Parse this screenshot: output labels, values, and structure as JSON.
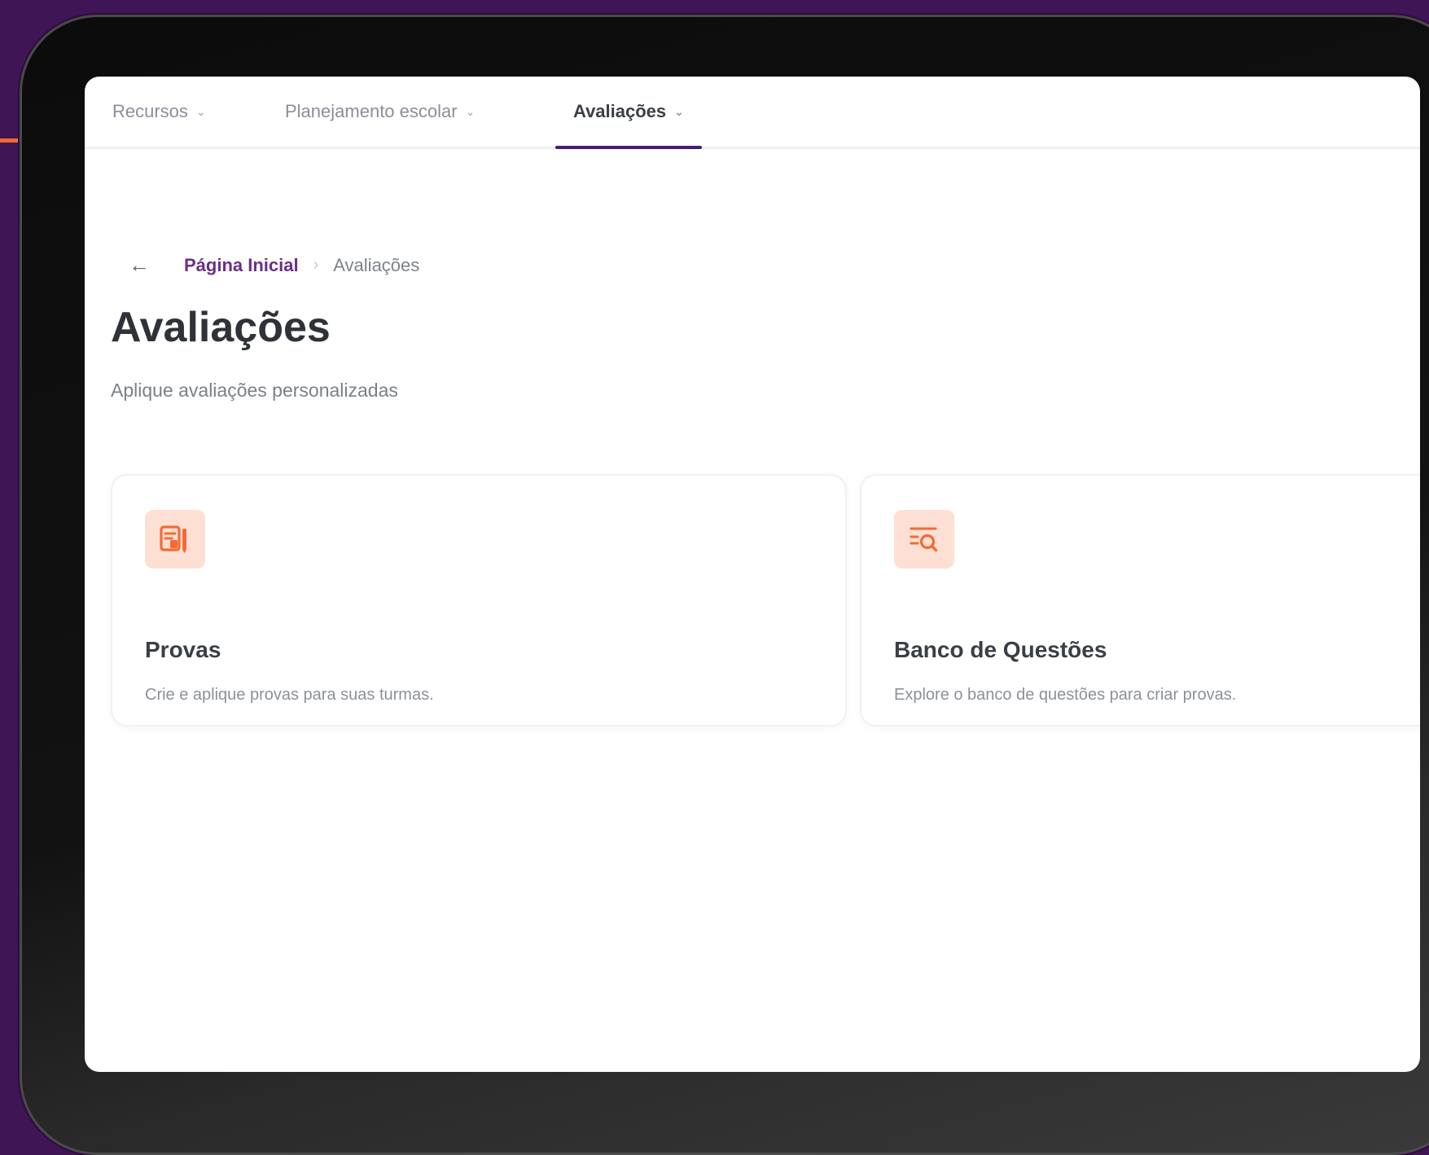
{
  "nav": {
    "items": [
      {
        "label": "Recursos"
      },
      {
        "label": "Planejamento escolar"
      },
      {
        "label": "Avaliações"
      }
    ]
  },
  "breadcrumb": {
    "home": "Página Inicial",
    "current": "Avaliações"
  },
  "page": {
    "title": "Avaliações",
    "subtitle": "Aplique avaliações personalizadas"
  },
  "cards": [
    {
      "title": "Provas",
      "description": "Crie e aplique provas para suas turmas.",
      "icon": "document-icon"
    },
    {
      "title": "Banco de Questões",
      "description": "Explore o banco de questões para criar provas.",
      "icon": "list-search-icon"
    }
  ],
  "colors": {
    "brand_purple": "#4b1c6b",
    "accent_orange": "#f2682f",
    "icon_bg": "#fde0d3"
  }
}
